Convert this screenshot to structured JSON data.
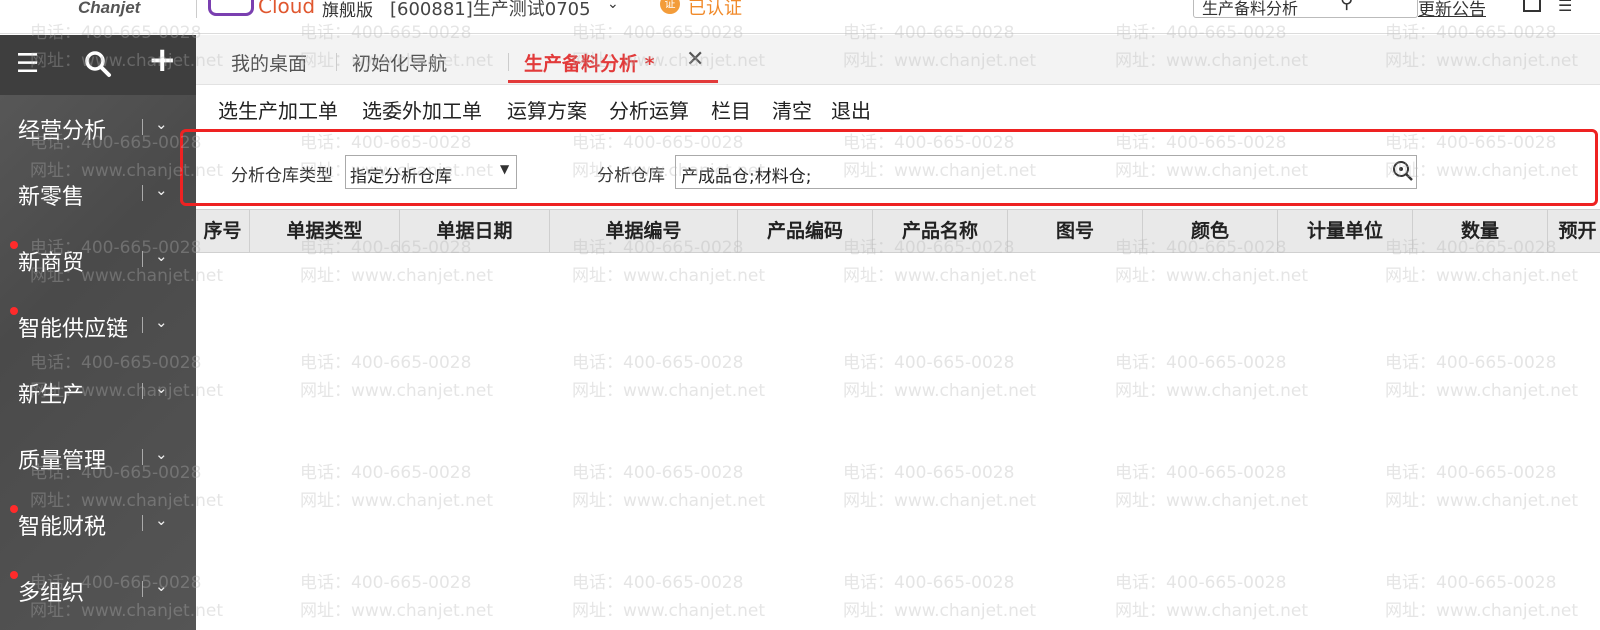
{
  "topbar": {
    "logo": "Chanjet",
    "product": "Cloud",
    "edition": "旗舰版",
    "account": "[600881]生产测试0705",
    "verified": "已认证",
    "verify_badge": "证",
    "search_value": "生产备料分析",
    "notice": "更新公告"
  },
  "sidebar": {
    "items": [
      {
        "label": "经营分析",
        "dot": false
      },
      {
        "label": "新零售",
        "dot": false
      },
      {
        "label": "新商贸",
        "dot": true
      },
      {
        "label": "智能供应链",
        "dot": true
      },
      {
        "label": "新生产",
        "dot": false
      },
      {
        "label": "质量管理",
        "dot": false
      },
      {
        "label": "智能财税",
        "dot": true
      },
      {
        "label": "多组织",
        "dot": true
      }
    ]
  },
  "tabs": [
    {
      "label": "我的桌面"
    },
    {
      "label": "初始化导航"
    },
    {
      "label": "生产备料分析 *"
    }
  ],
  "toolbar": {
    "buttons": [
      "选生产加工单",
      "选委外加工单",
      "运算方案",
      "分析运算",
      "栏目",
      "清空",
      "退出"
    ]
  },
  "filter": {
    "warehouse_type_label": "分析仓库类型",
    "warehouse_type_value": "指定分析仓库",
    "warehouse_label": "分析仓库",
    "warehouse_value": "产成品仓;材料仓;"
  },
  "grid": {
    "columns": [
      "序号",
      "单据类型",
      "单据日期",
      "单据编号",
      "产品编码",
      "产品名称",
      "图号",
      "颜色",
      "计量单位",
      "数量",
      "预开"
    ]
  },
  "watermark": {
    "phone": "电话：400-665-0028",
    "site": "网址：www.chanjet.net"
  },
  "colors": {
    "accent": "#e23a3a",
    "highlight_box": "#ee2222",
    "sidebar_bg": "#4e4e4e"
  }
}
